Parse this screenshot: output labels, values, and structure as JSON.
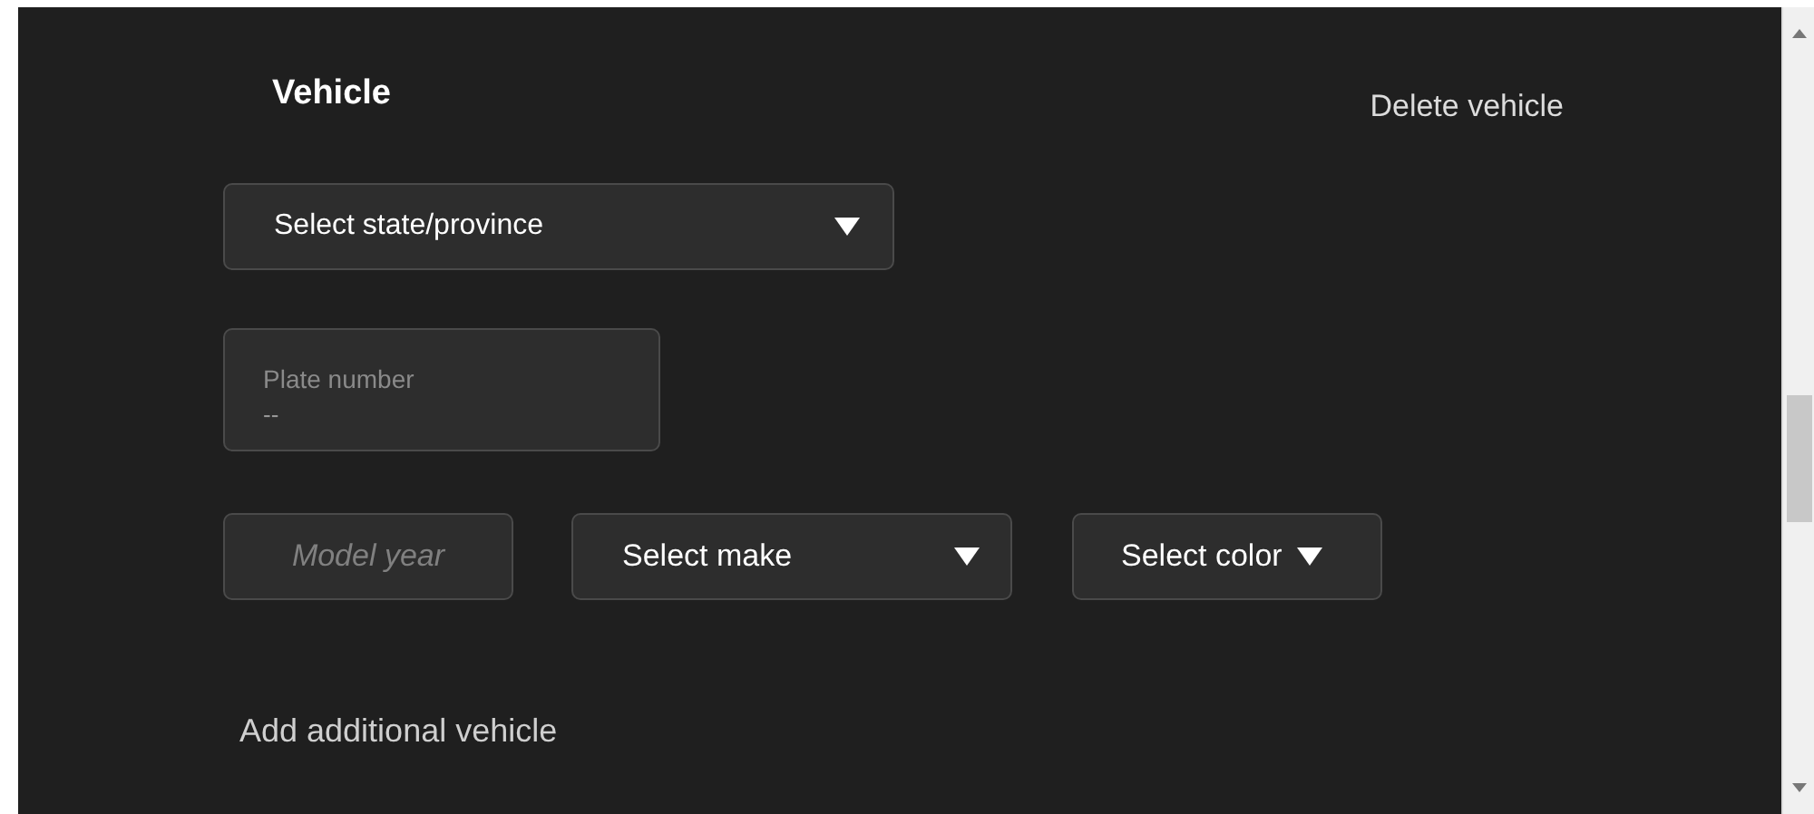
{
  "section": {
    "title": "Vehicle",
    "delete_link": "Delete vehicle"
  },
  "state_select": {
    "label": "Select state/province"
  },
  "plate_field": {
    "label": "Plate number",
    "value": "--"
  },
  "model_year": {
    "placeholder": "Model year"
  },
  "make_select": {
    "label": "Select make"
  },
  "color_select": {
    "label": "Select color"
  },
  "add_link": "Add additional vehicle"
}
